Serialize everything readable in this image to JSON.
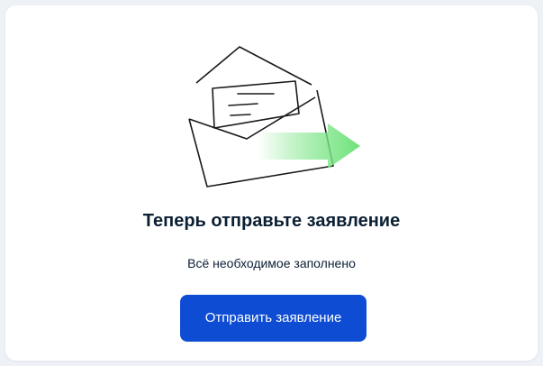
{
  "content": {
    "title": "Теперь отправьте заявление",
    "subtitle": "Всё необходимое заполнено",
    "submit_label": "Отправить заявление"
  },
  "icons": {
    "illustration": "envelope-send-icon"
  },
  "colors": {
    "primary": "#0d4cd3",
    "text": "#0b1f33",
    "arrow": "#6ee27a",
    "background": "#eef2f7"
  }
}
